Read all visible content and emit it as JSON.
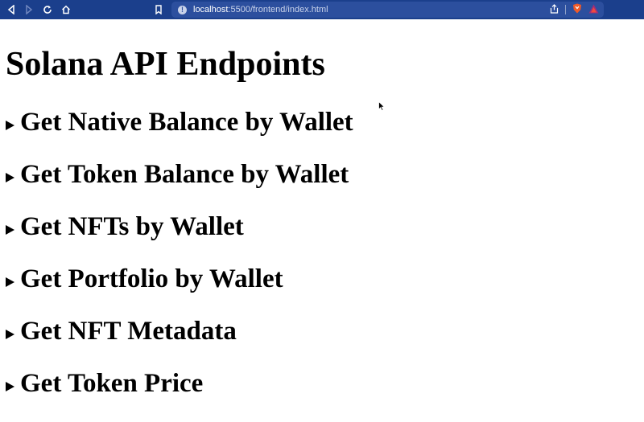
{
  "browser": {
    "url_host": "localhost",
    "url_path": ":5500/frontend/index.html"
  },
  "page": {
    "title": "Solana API Endpoints",
    "sections": [
      {
        "label": "Get Native Balance by Wallet"
      },
      {
        "label": "Get Token Balance by Wallet"
      },
      {
        "label": "Get NFTs by Wallet"
      },
      {
        "label": "Get Portfolio by Wallet"
      },
      {
        "label": "Get NFT Metadata"
      },
      {
        "label": "Get Token Price"
      }
    ]
  },
  "colors": {
    "toolbar": "#1b3f8c",
    "url_bar": "#2c4f9e",
    "brave_orange": "#f05a28"
  }
}
